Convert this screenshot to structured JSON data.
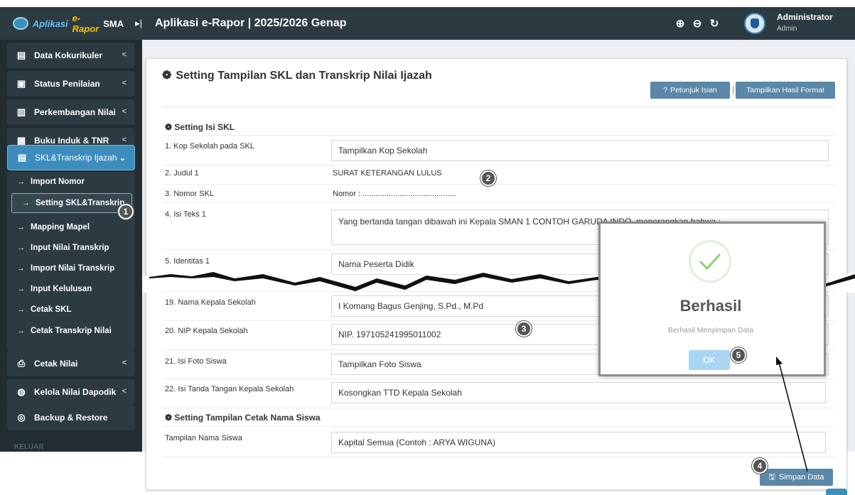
{
  "brand": {
    "part1": "Aplikasi",
    "part2": "e-Rapor",
    "part3": "SMA",
    "toggle_icon": "sidebar-toggle-icon"
  },
  "header": {
    "title": "Aplikasi e-Rapor | 2025/2026 Genap",
    "tools": [
      "zoom-in-icon",
      "zoom-out-icon",
      "reset-zoom-icon"
    ],
    "user_name": "Administrator",
    "user_role": "Admin"
  },
  "sidebar": {
    "items": [
      {
        "label": "Data Kokurikuler",
        "icon": "▤"
      },
      {
        "label": "Status Penilaian",
        "icon": "▣"
      },
      {
        "label": "Perkembangan Nilai",
        "icon": "▥"
      },
      {
        "label": "Buku Induk & TNR",
        "icon": "▦"
      },
      {
        "label": "SKL&Transkrip Ijazah",
        "icon": "▤"
      },
      {
        "label": "Cetak Nilai",
        "icon": "⎙"
      },
      {
        "label": "Kelola Nilai Dapodik",
        "icon": "◍"
      },
      {
        "label": "Backup & Restore",
        "icon": "◎"
      }
    ],
    "submenu": [
      "Import Nomor",
      "Setting SKL&Transkrip",
      "Mapping Mapel",
      "Input Nilai Transkrip",
      "Import Nilai Transkrip",
      "Input Kelulusan",
      "Cetak SKL",
      "Cetak Transkrip Nilai"
    ],
    "logout": "KELUAR"
  },
  "page": {
    "title": "Setting Tampilan SKL dan Transkrip Nilai Ijazah",
    "btn_petunjuk": "Petunjuk Isian",
    "btn_separator": "|",
    "btn_format": "Tampilkan Hasil Format",
    "section_skl": "Setting Isi SKL",
    "section_nama": "Setting Tampilan Cetak Nama Siswa",
    "rows": [
      {
        "label": "1. Kop Sekolah pada SKL",
        "value": "Tampilkan Kop Sekolah"
      },
      {
        "label": "2. Judul 1",
        "value": "SURAT KETERANGAN LULUS"
      },
      {
        "label": "3. Nomor SKL",
        "value": "Nomor : ..........................................."
      },
      {
        "label": "4. Isi Teks 1",
        "value": "Yang bertanda tangan dibawah ini Kepala SMAN 1 CONTOH GARUDA INDO, menerangkan bahwa :"
      },
      {
        "label": "5. Identitas 1",
        "value": "Nama Peserta Didik"
      },
      {
        "label": "19. Nama Kepala Sekolah",
        "value": "I Komang Bagus Genjing, S.Pd., M.Pd"
      },
      {
        "label": "20. NIP Kepala Sekolah",
        "value": "NIP. 197105241995011002"
      },
      {
        "label": "21. Isi Foto Siswa",
        "value": "Tampilkan Foto Siswa"
      },
      {
        "label": "22. Isi Tanda Tangan Kepala Sekolah",
        "value": "Kosongkan TTD Kepala Sekolah"
      },
      {
        "label": "Tampilan Nama Siswa",
        "value": "Kapital Semua (Contoh : ARYA WIGUNA)"
      }
    ],
    "btn_simpan": "Simpan Data"
  },
  "modal": {
    "title": "Berhasil",
    "text": "Berhasil Menyimpan Data",
    "ok": "OK"
  },
  "steps": [
    "1",
    "2",
    "3",
    "4",
    "5"
  ],
  "colors": {
    "sidebar": "#222d32",
    "topbar": "#2c3b41",
    "accent": "#3c8dbc",
    "button": "#5b87a8",
    "success": "#8cd06a"
  }
}
